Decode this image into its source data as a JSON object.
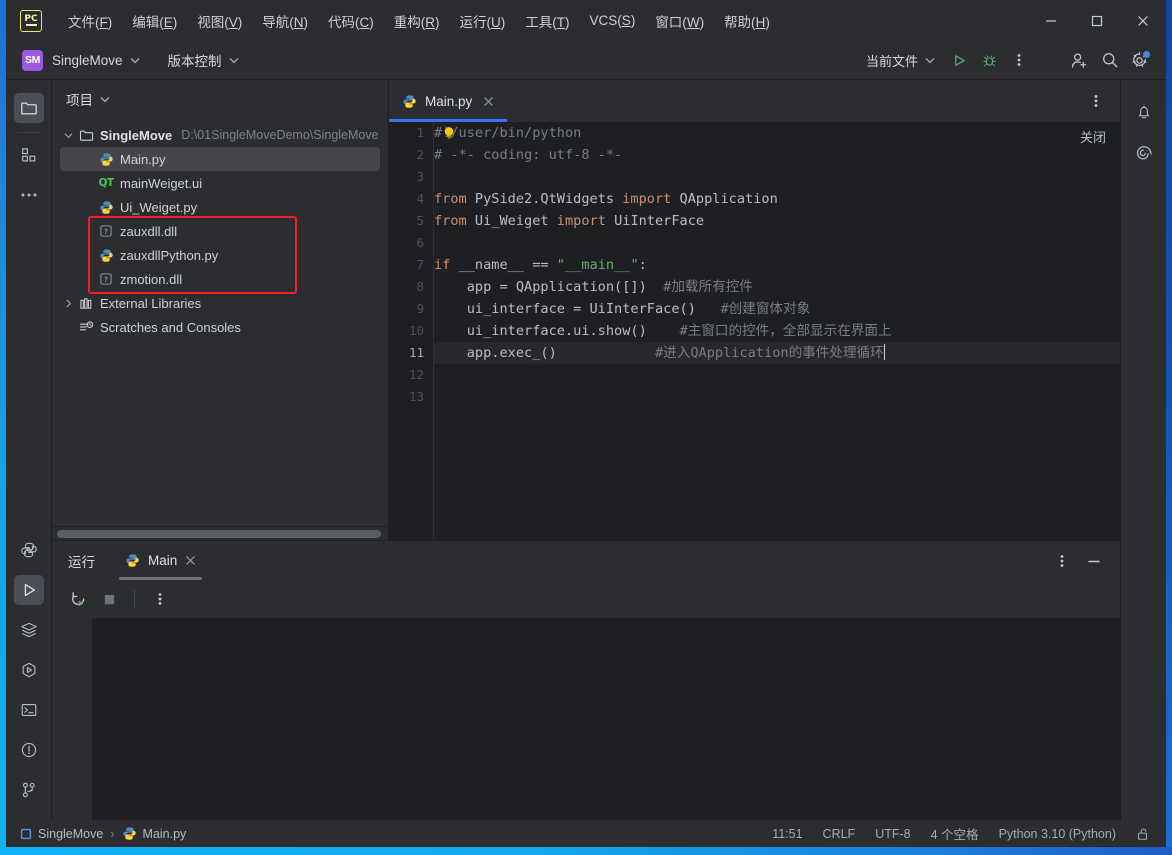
{
  "window": {
    "logo_text": "PC",
    "controls": {
      "minimize": "minimize-icon",
      "maximize": "maximize-icon",
      "close": "close-icon"
    }
  },
  "menubar": [
    {
      "label": "文件",
      "mnemonic": "F"
    },
    {
      "label": "编辑",
      "mnemonic": "E"
    },
    {
      "label": "视图",
      "mnemonic": "V"
    },
    {
      "label": "导航",
      "mnemonic": "N"
    },
    {
      "label": "代码",
      "mnemonic": "C"
    },
    {
      "label": "重构",
      "mnemonic": "R"
    },
    {
      "label": "运行",
      "mnemonic": "U"
    },
    {
      "label": "工具",
      "mnemonic": "T"
    },
    {
      "label": "VCS",
      "mnemonic": "S"
    },
    {
      "label": "窗口",
      "mnemonic": "W"
    },
    {
      "label": "帮助",
      "mnemonic": "H"
    }
  ],
  "toolbar": {
    "project_badge": "SM",
    "project_name": "SingleMove",
    "vcs_label": "版本控制",
    "run_config": "当前文件",
    "run_icon": "run-icon",
    "debug_icon": "debug-icon",
    "more_icon": "more-vertical-icon",
    "account_icon": "add-user-icon",
    "search_icon": "search-icon",
    "settings_icon": "gear-icon",
    "accent_green": "#59a869",
    "accent_blue": "#3574f0",
    "badge_purple": "#9a5ae0"
  },
  "left_rail": {
    "top": [
      {
        "name": "project-icon",
        "active": true
      },
      {
        "name": "structure-icon",
        "active": false
      },
      {
        "name": "more-options-icon",
        "active": false
      }
    ],
    "bottom": [
      {
        "name": "python-console-icon",
        "active": false
      },
      {
        "name": "run-icon",
        "active": true
      },
      {
        "name": "services-icon",
        "active": false
      },
      {
        "name": "run-anything-icon",
        "active": false
      },
      {
        "name": "terminal-icon",
        "active": false
      },
      {
        "name": "problems-icon",
        "active": false
      },
      {
        "name": "version-control-icon",
        "active": false
      }
    ]
  },
  "right_rail": [
    {
      "name": "notifications-icon"
    },
    {
      "name": "ai-assistant-icon"
    }
  ],
  "project_panel": {
    "title": "项目",
    "chevron": "chevron-down-icon",
    "tree": [
      {
        "label": "SingleMove",
        "path": "D:\\01SingleMoveDemo\\SingleMove",
        "icon": "folder-icon",
        "twist": "expanded",
        "indent": 0,
        "bold": true,
        "selected": false
      },
      {
        "label": "Main.py",
        "path": "",
        "icon": "python-file-icon",
        "twist": "none",
        "indent": 1,
        "bold": false,
        "selected": true
      },
      {
        "label": "mainWeiget.ui",
        "path": "",
        "icon": "qt-file-icon",
        "twist": "none",
        "indent": 1,
        "bold": false,
        "selected": false
      },
      {
        "label": "Ui_Weiget.py",
        "path": "",
        "icon": "python-file-icon",
        "twist": "none",
        "indent": 1,
        "bold": false,
        "selected": false
      },
      {
        "label": "zauxdll.dll",
        "path": "",
        "icon": "unknown-file-icon",
        "twist": "none",
        "indent": 1,
        "bold": false,
        "selected": false
      },
      {
        "label": "zauxdllPython.py",
        "path": "",
        "icon": "python-file-icon",
        "twist": "none",
        "indent": 1,
        "bold": false,
        "selected": false
      },
      {
        "label": "zmotion.dll",
        "path": "",
        "icon": "unknown-file-icon",
        "twist": "none",
        "indent": 1,
        "bold": false,
        "selected": false
      },
      {
        "label": "External Libraries",
        "path": "",
        "icon": "library-icon",
        "twist": "collapsed",
        "indent": 0,
        "bold": false,
        "selected": false
      },
      {
        "label": "Scratches and Consoles",
        "path": "",
        "icon": "scratches-icon",
        "twist": "none",
        "indent": 0,
        "bold": false,
        "selected": false
      }
    ],
    "annotation": {
      "color": "#ee2222",
      "covers": [
        "zauxdll.dll",
        "zauxdllPython.py",
        "zmotion.dll"
      ]
    }
  },
  "editor": {
    "tab": {
      "label": "Main.py",
      "icon": "python-file-icon",
      "close": "close-icon"
    },
    "close_label": "关闭",
    "more_icon": "more-vertical-icon",
    "active_line": 11,
    "bulb_line": 10,
    "lines": [
      {
        "n": 1,
        "tokens": [
          {
            "t": "#!/user/bin/python",
            "c": "cm"
          }
        ]
      },
      {
        "n": 2,
        "tokens": [
          {
            "t": "# -*- coding: utf-8 -*-",
            "c": "cm"
          }
        ]
      },
      {
        "n": 3,
        "tokens": []
      },
      {
        "n": 4,
        "tokens": [
          {
            "t": "from",
            "c": "k"
          },
          {
            "t": " PySide2.QtWidgets ",
            "c": "id"
          },
          {
            "t": "import",
            "c": "k"
          },
          {
            "t": " QApplication",
            "c": "id"
          }
        ]
      },
      {
        "n": 5,
        "tokens": [
          {
            "t": "from",
            "c": "k"
          },
          {
            "t": " Ui_Weiget ",
            "c": "id"
          },
          {
            "t": "import",
            "c": "k"
          },
          {
            "t": " UiInterFace",
            "c": "id"
          }
        ]
      },
      {
        "n": 6,
        "tokens": []
      },
      {
        "n": 7,
        "tokens": [
          {
            "t": "if",
            "c": "k"
          },
          {
            "t": " __name__ == ",
            "c": "id"
          },
          {
            "t": "\"__main__\"",
            "c": "s"
          },
          {
            "t": ":",
            "c": "id"
          }
        ]
      },
      {
        "n": 8,
        "tokens": [
          {
            "t": "    app = QApplication([])  ",
            "c": "id"
          },
          {
            "t": "#加载所有控件",
            "c": "cm"
          }
        ]
      },
      {
        "n": 9,
        "tokens": [
          {
            "t": "    ui_interface = UiInterFace()   ",
            "c": "id"
          },
          {
            "t": "#创建窗体对象",
            "c": "cm"
          }
        ]
      },
      {
        "n": 10,
        "tokens": [
          {
            "t": "    ui_interface.ui.show()    ",
            "c": "id"
          },
          {
            "t": "#主窗口的控件，全部显示在界面上",
            "c": "cm"
          }
        ]
      },
      {
        "n": 11,
        "tokens": [
          {
            "t": "    app.exec_()            ",
            "c": "id"
          },
          {
            "t": "#进入QApplication的事件处理循环",
            "c": "cm"
          }
        ]
      },
      {
        "n": 12,
        "tokens": []
      },
      {
        "n": 13,
        "tokens": []
      }
    ]
  },
  "run_panel": {
    "title": "运行",
    "tab": {
      "label": "Main",
      "icon": "python-file-icon",
      "close": "close-icon"
    },
    "rerun_icon": "rerun-icon",
    "stop_icon": "stop-icon",
    "more_icon": "more-vertical-icon",
    "options_icon": "more-vertical-icon",
    "minimize_icon": "minimize-icon",
    "console_text": ""
  },
  "statusbar": {
    "breadcrumbs": [
      {
        "label": "SingleMove",
        "icon": "module-icon"
      },
      {
        "label": "Main.py",
        "icon": "python-file-icon"
      }
    ],
    "separator": "›",
    "caret_position": "11:51",
    "line_separator": "CRLF",
    "encoding": "UTF-8",
    "indent": "4 个空格",
    "interpreter": "Python 3.10 (Python)",
    "lock_icon": "unlocked-icon"
  }
}
